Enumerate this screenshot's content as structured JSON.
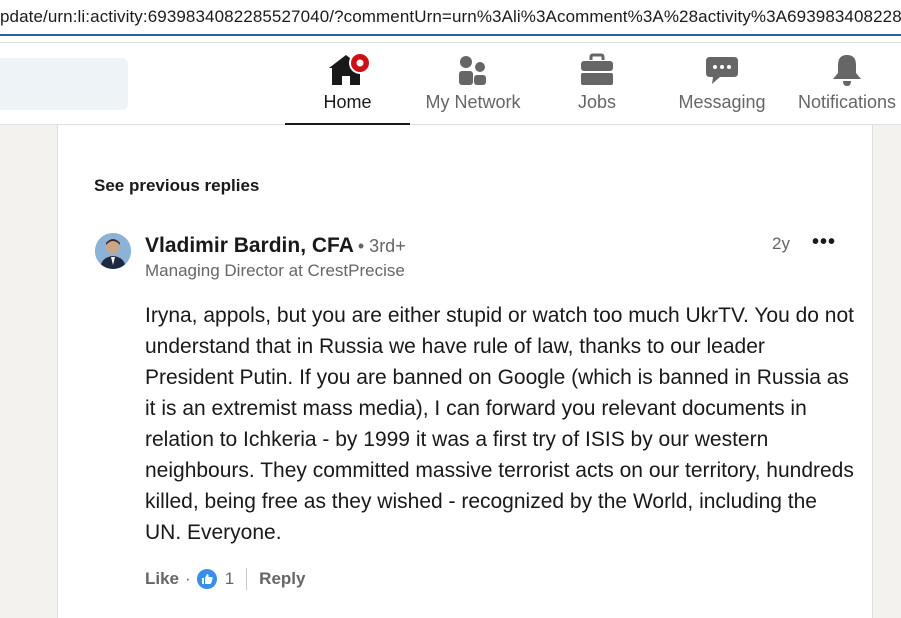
{
  "browser": {
    "url": "pdate/urn:li:activity:6939834082285527040/?commentUrn=urn%3Ali%3Acomment%3A%28activity%3A693983408228"
  },
  "nav": {
    "items": [
      {
        "label": "Home",
        "icon": "home-icon",
        "active": true
      },
      {
        "label": "My Network",
        "icon": "people-icon",
        "active": false
      },
      {
        "label": "Jobs",
        "icon": "briefcase-icon",
        "active": false
      },
      {
        "label": "Messaging",
        "icon": "chat-icon",
        "active": false
      },
      {
        "label": "Notifications",
        "icon": "bell-icon",
        "active": false
      }
    ],
    "notification_dot_color": "#cc1016"
  },
  "thread": {
    "see_previous": "See previous replies"
  },
  "comment": {
    "author": "Vladimir Bardin, CFA",
    "degree": "• 3rd+",
    "headline": "Managing Director at CrestPrecise",
    "time": "2y",
    "more": "•••",
    "body": "Iryna, appols, but you are either stupid or watch too much UkrTV. You do not understand that in Russia we have rule of law, thanks to our leader President Putin. If you are banned on Google (which is banned in Russia as it is an extremist mass media), I can forward you relevant documents in relation to Ichkeria - by 1999 it was a first try of ISIS by our western neighbours. They committed massive terrorist acts on our territory, hundreds killed, being free as they wished - recognized by the World, including the UN. Everyone.",
    "like_label": "Like",
    "dot": "·",
    "reaction_count": "1",
    "reply_label": "Reply"
  },
  "colors": {
    "accent": "#378fe9",
    "text_primary": "#191919",
    "text_secondary": "#666666",
    "feed_bg": "#f4f2ee"
  }
}
